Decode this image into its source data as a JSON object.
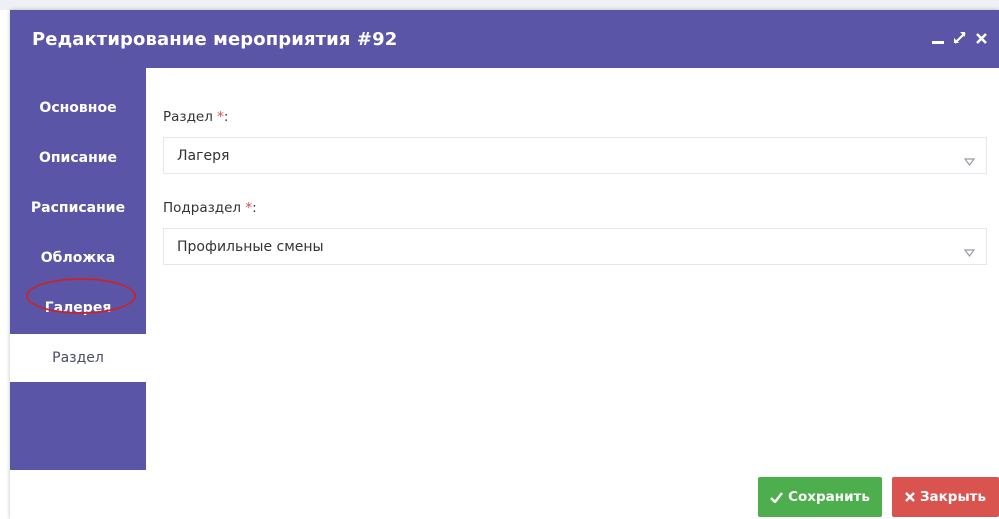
{
  "dialog": {
    "title": "Редактирование мероприятия #92",
    "controls": [
      "minimize-icon",
      "maximize-icon",
      "close-icon"
    ]
  },
  "sidebar": {
    "items": [
      {
        "label": "Основное",
        "active": false
      },
      {
        "label": "Описание",
        "active": false
      },
      {
        "label": "Расписание",
        "active": false
      },
      {
        "label": "Обложка",
        "active": false
      },
      {
        "label": "Галерея",
        "active": false
      },
      {
        "label": "Раздел",
        "active": true
      }
    ]
  },
  "form": {
    "section": {
      "label": "Раздел",
      "required_mark": "*",
      "colon": ":",
      "value": "Лагеря"
    },
    "subsection": {
      "label": "Подраздел",
      "required_mark": "*",
      "colon": ":",
      "value": "Профильные смены"
    }
  },
  "buttons": {
    "save": {
      "label": "Сохранить",
      "icon": "check-icon"
    },
    "close": {
      "label": "Закрыть",
      "icon": "x-icon"
    }
  },
  "colors": {
    "header": "#5b55a8",
    "save": "#4cae4c",
    "close": "#d9534f",
    "required": "#e04646",
    "annotation": "#c0282f"
  }
}
